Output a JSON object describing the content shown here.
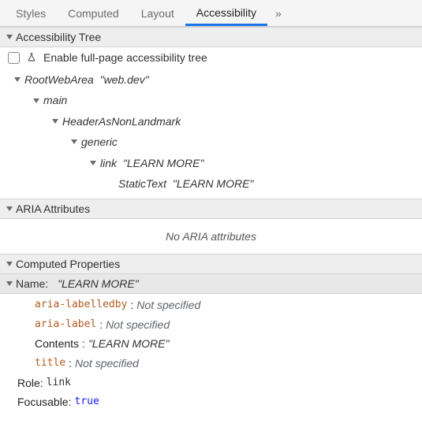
{
  "tabs": {
    "items": [
      "Styles",
      "Computed",
      "Layout",
      "Accessibility"
    ],
    "active": 3,
    "more": "»"
  },
  "sections": {
    "tree_title": "Accessibility Tree",
    "aria_title": "ARIA Attributes",
    "computed_title": "Computed Properties"
  },
  "tree": {
    "enable_label": "Enable full-page accessibility tree",
    "n0_role": "RootWebArea",
    "n0_name": "web.dev",
    "n1_role": "main",
    "n2_role": "HeaderAsNonLandmark",
    "n3_role": "generic",
    "n4_role": "link",
    "n4_name": "LEARN MORE",
    "n5_role": "StaticText",
    "n5_name": "LEARN MORE"
  },
  "aria": {
    "empty": "No ARIA attributes"
  },
  "computed": {
    "name_label": "Name:",
    "name_value": "LEARN MORE",
    "p0k": "aria-labelledby",
    "p0v": "Not specified",
    "p1k": "aria-label",
    "p1v": "Not specified",
    "p2k": "Contents",
    "p2v": "LEARN MORE",
    "p3k": "title",
    "p3v": "Not specified",
    "role_k": "Role:",
    "role_v": "link",
    "focus_k": "Focusable:",
    "focus_v": "true"
  }
}
